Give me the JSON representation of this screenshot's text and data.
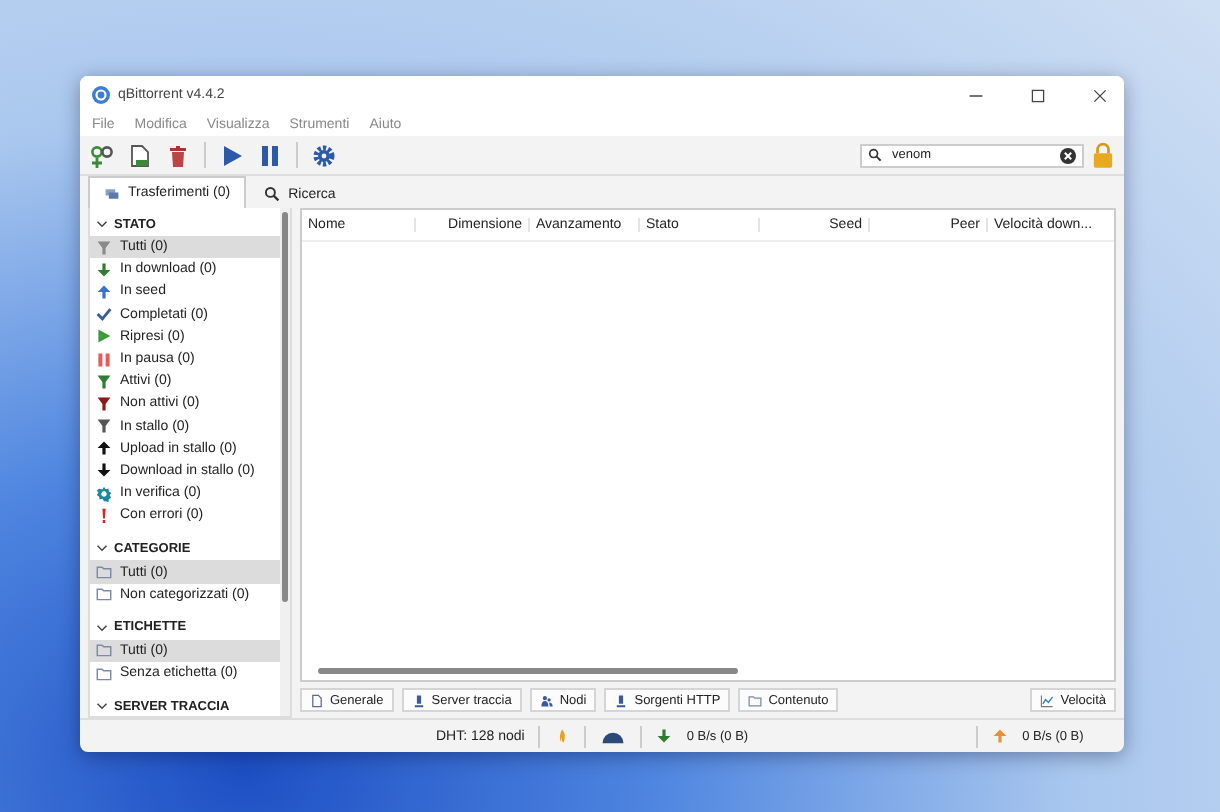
{
  "window": {
    "title": "qBittorrent v4.4.2"
  },
  "menu": [
    "File",
    "Modifica",
    "Visualizza",
    "Strumenti",
    "Aiuto"
  ],
  "search": {
    "value": "venom"
  },
  "tabs": [
    {
      "label": "Trasferimenti (0)",
      "kind": "transfers",
      "selected": true
    },
    {
      "label": "Ricerca",
      "kind": "search",
      "selected": false
    }
  ],
  "sidebar": [
    {
      "title": "STATO",
      "expanded": true,
      "items": [
        {
          "label": "Tutti (0)",
          "kind": "filter",
          "color": "#8a8a8a",
          "selected": true
        },
        {
          "label": "In download (0)",
          "kind": "down",
          "color": "#2e7d32",
          "selected": false
        },
        {
          "label": "In seed",
          "kind": "up",
          "color": "#3b6fd4",
          "selected": false
        },
        {
          "label": "Completati (0)",
          "kind": "check",
          "color": "#3a5a9a",
          "selected": false
        },
        {
          "label": "Ripresi (0)",
          "kind": "play",
          "color": "#3c9a3c",
          "selected": false
        },
        {
          "label": "In pausa (0)",
          "kind": "pause",
          "color": "#e85a5a",
          "selected": false
        },
        {
          "label": "Attivi (0)",
          "kind": "filter",
          "color": "#2e7d32",
          "selected": false
        },
        {
          "label": "Non attivi (0)",
          "kind": "filter",
          "color": "#8b1a1a",
          "selected": false
        },
        {
          "label": "In stallo (0)",
          "kind": "filter",
          "color": "#555555",
          "selected": false
        },
        {
          "label": "Upload in stallo (0)",
          "kind": "up",
          "color": "#111111",
          "selected": false
        },
        {
          "label": "Download in stallo (0)",
          "kind": "down",
          "color": "#111111",
          "selected": false
        },
        {
          "label": "In verifica (0)",
          "kind": "gear",
          "color": "#1a8a9a",
          "selected": false
        },
        {
          "label": "Con errori (0)",
          "kind": "error",
          "color": "#e02020",
          "selected": false
        }
      ]
    },
    {
      "title": "CATEGORIE",
      "expanded": true,
      "items": [
        {
          "label": "Tutti (0)",
          "kind": "folder",
          "color": "#7a8aa8",
          "selected": true
        },
        {
          "label": "Non categorizzati (0)",
          "kind": "folder",
          "color": "#7a8aa8",
          "selected": false
        }
      ]
    },
    {
      "title": "ETICHETTE",
      "expanded": true,
      "items": [
        {
          "label": "Tutti (0)",
          "kind": "folder",
          "color": "#7a8aa8",
          "selected": true
        },
        {
          "label": "Senza etichetta (0)",
          "kind": "folder",
          "color": "#7a8aa8",
          "selected": false
        }
      ]
    },
    {
      "title": "SERVER TRACCIA",
      "expanded": true
    }
  ],
  "table": {
    "columns": [
      "Nome",
      "Dimensione",
      "Avanzamento",
      "Stato",
      "Seed",
      "Peer",
      "Velocità down..."
    ]
  },
  "bottom_tabs": [
    {
      "label": "Generale",
      "kind": "doc"
    },
    {
      "label": "Server traccia",
      "kind": "server"
    },
    {
      "label": "Nodi",
      "kind": "people"
    },
    {
      "label": "Sorgenti HTTP",
      "kind": "server"
    },
    {
      "label": "Contenuto",
      "kind": "folder"
    }
  ],
  "speed_button": {
    "label": "Velocità"
  },
  "status_bar": {
    "dht": "DHT: 128 nodi",
    "download": "0 B/s (0 B)",
    "upload": "0 B/s (0 B)"
  }
}
